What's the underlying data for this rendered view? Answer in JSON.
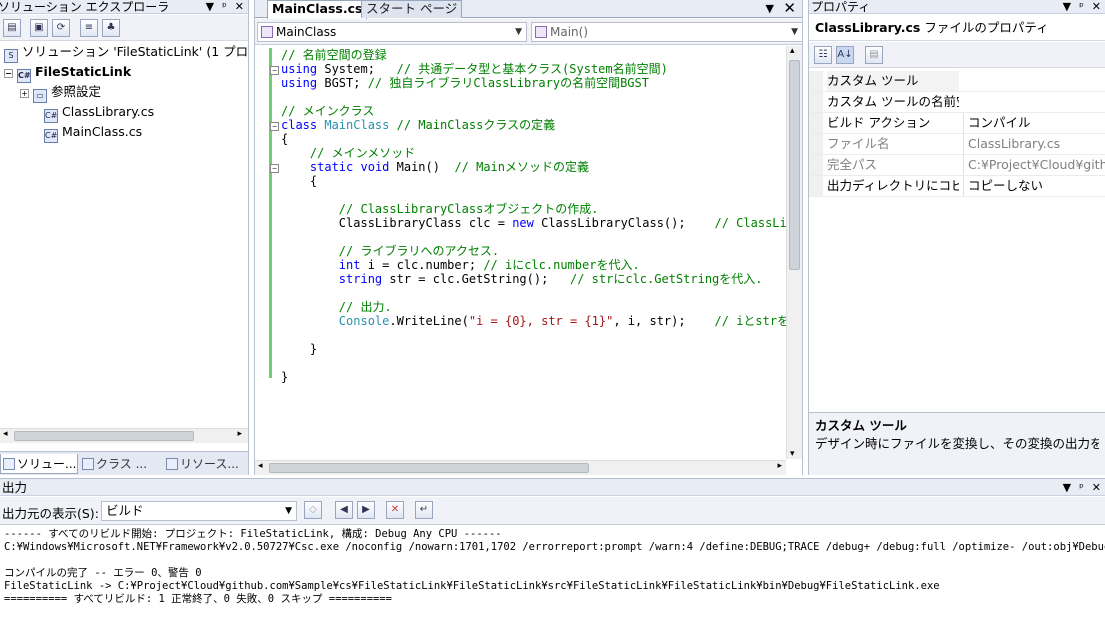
{
  "solution_explorer": {
    "title": "ソリューション エクスプローラ",
    "tree": [
      {
        "label": "ソリューション 'FileStaticLink' (1 プロジ",
        "icon": "solution-icon"
      },
      {
        "label": "FileStaticLink",
        "icon": "csharp-project-icon"
      },
      {
        "label": "参照設定",
        "icon": "references-folder-icon"
      },
      {
        "label": "ClassLibrary.cs",
        "icon": "cs-file-icon"
      },
      {
        "label": "MainClass.cs",
        "icon": "cs-file-icon"
      }
    ],
    "bottom_tabs": [
      "ソリュー...",
      "クラス ...",
      "リソース..."
    ]
  },
  "editor": {
    "tabs": [
      "MainClass.cs",
      "スタート ページ"
    ],
    "type_selector": "MainClass",
    "member_selector": "Main()",
    "lines": [
      "// 名前空間の登録",
      "using System;   // 共通データ型と基本クラス(System名前空間)",
      "using BGST; // 独自ライブラリClassLibraryの名前空間BGST",
      "",
      "// メインクラス",
      "class MainClass // MainClassクラスの定義",
      "{",
      "    // メインメソッド",
      "    static void Main()  // Mainメソッドの定義",
      "    {",
      "",
      "        // ClassLibraryClassオブジェクトの作成.",
      "        ClassLibraryClass clc = new ClassLibraryClass();    // ClassLibr",
      "",
      "        // ライブラリへのアクセス.",
      "        int i = clc.number; // iにclc.numberを代入.",
      "        string str = clc.GetString();   // strにclc.GetStringを代入.",
      "",
      "        // 出力.",
      "        Console.WriteLine(\"i = {0}, str = {1}\", i, str);    // iとstrを出",
      "",
      "    }",
      "",
      "}"
    ]
  },
  "properties": {
    "title": "プロパティ",
    "header": "ClassLibrary.cs ファイルのプロパティ",
    "rows": [
      {
        "name": "カスタム ツール",
        "value": ""
      },
      {
        "name": "カスタム ツールの名前空",
        "value": ""
      },
      {
        "name": "ビルド アクション",
        "value": "コンパイル"
      },
      {
        "name": "ファイル名",
        "value": "ClassLibrary.cs"
      },
      {
        "name": "完全パス",
        "value": "C:¥Project¥Cloud¥github"
      },
      {
        "name": "出力ディレクトリにコピ",
        "value": "コピーしない"
      }
    ],
    "description_title": "カスタム ツール",
    "description_text": "デザイン時にファイルを変換し、その変換の出力を..."
  },
  "output": {
    "title": "出力",
    "source_label": "出力元の表示(S):",
    "source_value": "ビルド",
    "lines": [
      "------ すべてのリビルド開始: プロジェクト: FileStaticLink, 構成: Debug Any CPU ------",
      "C:¥Windows¥Microsoft.NET¥Framework¥v2.0.50727¥Csc.exe /noconfig /nowarn:1701,1702 /errorreport:prompt /warn:4 /define:DEBUG;TRACE /debug+ /debug:full /optimize- /out:obj¥Debug¥FileStaticLink.exe",
      "",
      "コンパイルの完了 -- エラー 0、警告 0",
      "FileStaticLink -> C:¥Project¥Cloud¥github.com¥Sample¥cs¥FileStaticLink¥FileStaticLink¥src¥FileStaticLink¥FileStaticLink¥bin¥Debug¥FileStaticLink.exe",
      "========== すべてリビルド: 1 正常終了、0 失敗、0 スキップ =========="
    ]
  }
}
